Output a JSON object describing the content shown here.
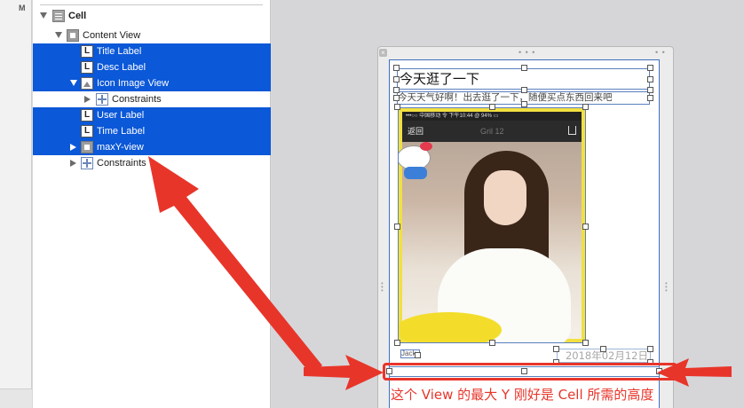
{
  "gutter": {
    "label": "M"
  },
  "outline": {
    "rows": [
      {
        "label": "Cell",
        "bold": true
      },
      {
        "label": "Content View"
      },
      {
        "label": "Title Label",
        "icon": "L"
      },
      {
        "label": "Desc Label",
        "icon": "L"
      },
      {
        "label": "Icon Image View"
      },
      {
        "label": "Constraints"
      },
      {
        "label": "User Label",
        "icon": "L"
      },
      {
        "label": "Time Label",
        "icon": "L"
      },
      {
        "label": "maxY-view"
      },
      {
        "label": "Constraints"
      }
    ]
  },
  "canvas": {
    "close_glyph": "×",
    "title_text": "今天逛了一下",
    "desc_text": "今天天气好啊！出去逛了一下，随便买点东西回来吧",
    "phone": {
      "status": "•••○○ 中国移动  令        下午10:44          @ 94% ▭",
      "back": "返回",
      "nav_title": "Gril 12"
    },
    "user_text": "Jack",
    "time_text": "2018年02月12日",
    "annotation": "这个 View 的最大 Y 刚好是 Cell 所需的高度",
    "accent_color": "#e8352a",
    "selection_color": "#0b58d8"
  }
}
